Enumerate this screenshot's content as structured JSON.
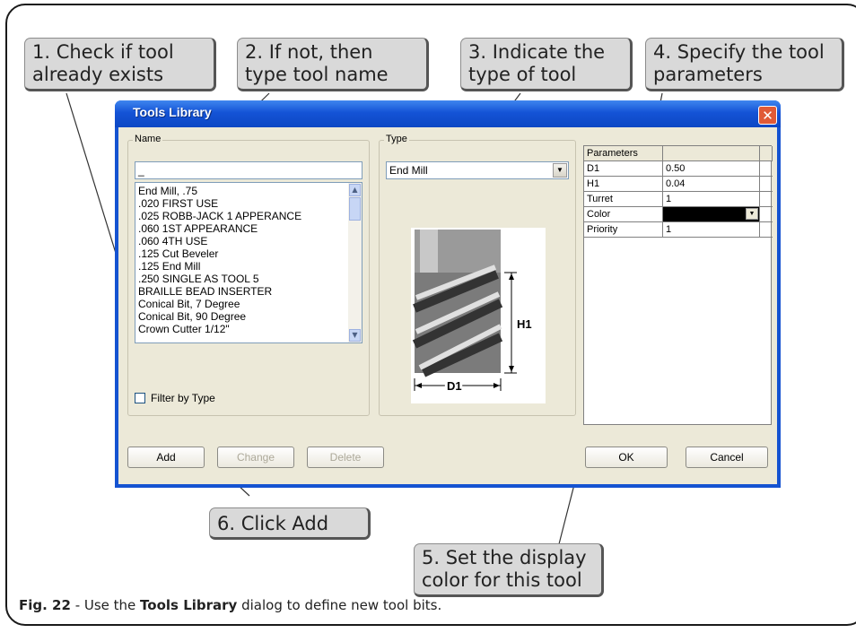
{
  "callouts": {
    "c1": "1. Check if tool\nalready exists",
    "c2": "2. If not, then\ntype tool name",
    "c3": "3. Indicate the\ntype of tool",
    "c4": "4. Specify the tool\nparameters",
    "c5": "5. Set the display\ncolor for this tool",
    "c6": "6. Click Add"
  },
  "dialog": {
    "title": "Tools Library",
    "close_glyph": "✕",
    "name_group": "Name",
    "name_value": "_",
    "tool_list": [
      "End Mill, .75",
      ".020 FIRST USE",
      ".025 ROBB-JACK 1 APPERANCE",
      ".060 1ST APPEARANCE",
      ".060 4TH USE",
      ".125 Cut Beveler",
      ".125 End Mill",
      ".250 SINGLE AS TOOL 5",
      "BRAILLE BEAD INSERTER",
      "Conical Bit, 7 Degree",
      "Conical Bit, 90 Degree",
      "Crown Cutter 1/12\""
    ],
    "filter_label": "Filter by Type",
    "type_group": "Type",
    "type_value": "End Mill",
    "diagram": {
      "h_label": "H1",
      "d_label": "D1"
    },
    "params_header": "Parameters",
    "params": [
      {
        "key": "D1",
        "value": "0.50"
      },
      {
        "key": "H1",
        "value": "0.04"
      },
      {
        "key": "Turret",
        "value": "1"
      },
      {
        "key": "Color",
        "value": "",
        "swatch": "#000000"
      },
      {
        "key": "Priority",
        "value": "1"
      }
    ],
    "buttons": {
      "add": "Add",
      "change": "Change",
      "delete": "Delete",
      "ok": "OK",
      "cancel": "Cancel"
    }
  },
  "caption": {
    "fig": "Fig. 22",
    "pre": " - Use the ",
    "bold": "Tools Library",
    "post": " dialog to define new tool bits."
  },
  "colors": {
    "titlebar": "#1453d6",
    "dialog_bg": "#ece9d8",
    "callout_bg": "#d9d9d9"
  }
}
